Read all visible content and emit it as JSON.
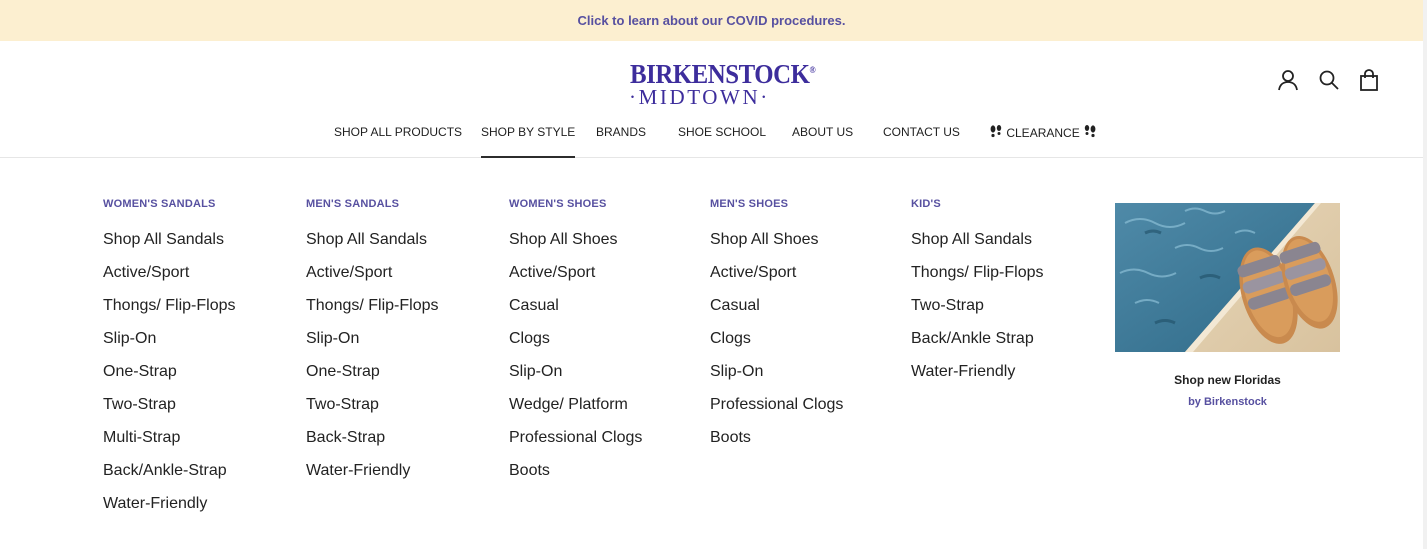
{
  "announcement": "Click to learn about our COVID procedures.",
  "logo": {
    "top": "BIRKENSTOCK",
    "reg": "®",
    "bottom": "·MIDTOWN·",
    "color": "#3d2d9c"
  },
  "header_icons": [
    "account-icon",
    "search-icon",
    "cart-bag-icon"
  ],
  "nav": {
    "items": [
      {
        "label": "SHOP ALL PRODUCTS"
      },
      {
        "label": "SHOP BY STYLE",
        "active": true
      },
      {
        "label": "BRANDS"
      },
      {
        "label": "SHOE SCHOOL"
      },
      {
        "label": "ABOUT US"
      },
      {
        "label": "CONTACT US"
      },
      {
        "label": "CLEARANCE",
        "icons": [
          "footprints-icon",
          "footprints-icon"
        ]
      }
    ]
  },
  "menu": {
    "columns": [
      {
        "heading": "WOMEN'S SANDALS",
        "links": [
          "Shop All Sandals",
          "Active/Sport",
          "Thongs/ Flip-Flops",
          "Slip-On",
          "One-Strap",
          "Two-Strap",
          "Multi-Strap",
          "Back/Ankle-Strap",
          "Water-Friendly"
        ]
      },
      {
        "heading": "MEN'S SANDALS",
        "links": [
          "Shop All Sandals",
          "Active/Sport",
          "Thongs/ Flip-Flops",
          "Slip-On",
          "One-Strap",
          "Two-Strap",
          "Back-Strap",
          "Water-Friendly"
        ]
      },
      {
        "heading": "WOMEN'S SHOES",
        "links": [
          "Shop All Shoes",
          "Active/Sport",
          "Casual",
          "Clogs",
          "Slip-On",
          "Wedge/ Platform",
          "Professional Clogs",
          "Boots"
        ]
      },
      {
        "heading": "MEN'S SHOES",
        "links": [
          "Shop All Shoes",
          "Active/Sport",
          "Casual",
          "Clogs",
          "Slip-On",
          "Professional Clogs",
          "Boots"
        ]
      },
      {
        "heading": "KID'S",
        "links": [
          "Shop All Sandals",
          "Thongs/ Flip-Flops",
          "Two-Strap",
          "Back/Ankle Strap",
          "Water-Friendly"
        ]
      }
    ],
    "promo": {
      "title": "Shop new Floridas",
      "subtitle": "by Birkenstock"
    }
  },
  "colors": {
    "announcement_bg": "#fcefd0",
    "accent": "#5750a0",
    "brand": "#3d2d9c"
  }
}
